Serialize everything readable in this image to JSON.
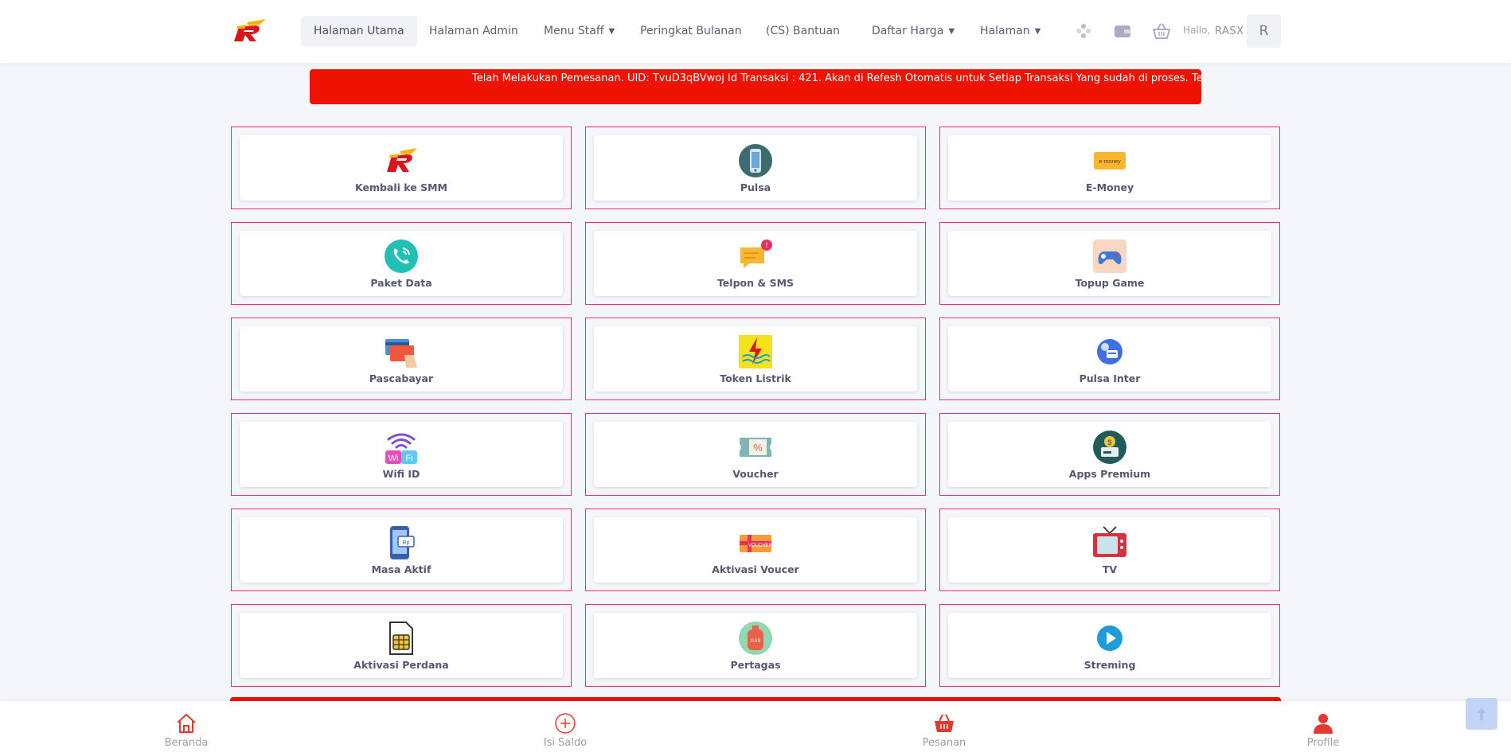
{
  "header": {
    "nav": [
      {
        "label": "Halaman Utama",
        "active": true,
        "dropdown": false
      },
      {
        "label": "Halaman Admin",
        "active": false,
        "dropdown": false
      },
      {
        "label": "Menu Staff",
        "active": false,
        "dropdown": true
      },
      {
        "label": "Peringkat Bulanan",
        "active": false,
        "dropdown": false
      },
      {
        "label": "(CS) Bantuan",
        "active": false,
        "dropdown": false
      },
      {
        "label": "Daftar Harga",
        "active": false,
        "dropdown": true
      },
      {
        "label": "Halaman",
        "active": false,
        "dropdown": true
      }
    ],
    "greeting": "Hallo,",
    "username": "RASX",
    "avatar_letter": "R",
    "icons": [
      "gamepad-icon",
      "wallet-icon",
      "basket-icon"
    ]
  },
  "announcement": "Telah Melakukan Pemesanan. UID: TvuD3qBVwoj Id Transaksi : 421. Akan di Refesh Otomatis untuk Setiap Transaksi Yang sudah di proses. Terima kasih",
  "services": [
    {
      "label": "Kembali ke SMM",
      "icon": "brand-logo-icon"
    },
    {
      "label": "Pulsa",
      "icon": "phone-icon"
    },
    {
      "label": "E-Money",
      "icon": "emoney-card-icon"
    },
    {
      "label": "Paket Data",
      "icon": "call-icon"
    },
    {
      "label": "Telpon & SMS",
      "icon": "chat-bubble-icon"
    },
    {
      "label": "Topup Game",
      "icon": "game-controller-icon"
    },
    {
      "label": "Pascabayar",
      "icon": "credit-card-icon"
    },
    {
      "label": "Token Listrik",
      "icon": "electricity-icon"
    },
    {
      "label": "Pulsa Inter",
      "icon": "globe-phone-icon"
    },
    {
      "label": "Wifi ID",
      "icon": "wifi-icon"
    },
    {
      "label": "Voucher",
      "icon": "ticket-icon"
    },
    {
      "label": "Apps Premium",
      "icon": "money-box-icon"
    },
    {
      "label": "Masa Aktif",
      "icon": "mobile-rp-icon"
    },
    {
      "label": "Aktivasi Voucer",
      "icon": "gift-voucher-icon"
    },
    {
      "label": "TV",
      "icon": "tv-icon"
    },
    {
      "label": "Aktivasi Perdana",
      "icon": "sim-card-icon"
    },
    {
      "label": "Pertagas",
      "icon": "gas-tank-icon"
    },
    {
      "label": "Streming",
      "icon": "play-icon"
    }
  ],
  "bottom_nav": [
    {
      "label": "Beranda",
      "icon": "home-icon"
    },
    {
      "label": "Isi Saldo",
      "icon": "plus-circle-icon"
    },
    {
      "label": "Pesanan",
      "icon": "basket-icon"
    },
    {
      "label": "Profile",
      "icon": "user-icon"
    }
  ],
  "colors": {
    "accent": "#ee1200",
    "tile_border": "#e8315c",
    "icon_red": "#e23a2e"
  }
}
